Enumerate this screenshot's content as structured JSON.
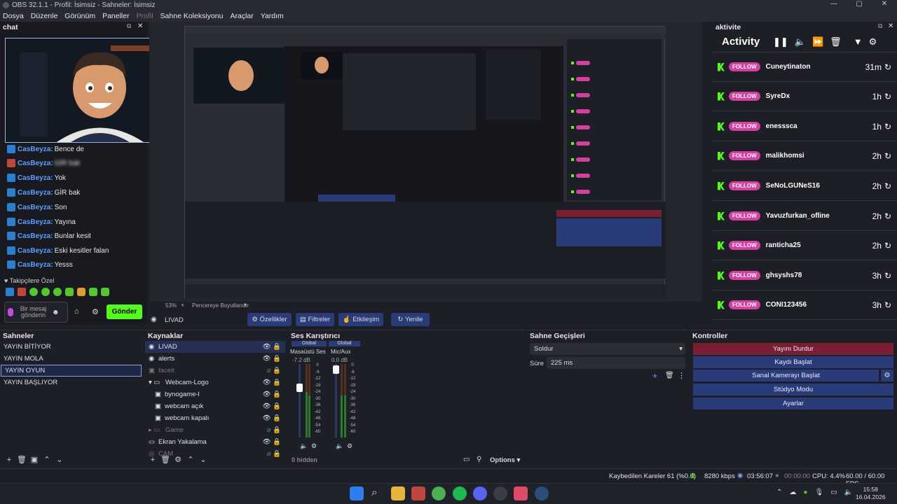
{
  "window": {
    "title": "OBS 32.1.1 - Profil: İsimsiz - Sahneler: İsimsiz",
    "min": "—",
    "max": "▢",
    "close": "✕"
  },
  "menu": [
    "Dosya",
    "Düzenle",
    "Görünüm",
    "Paneller",
    "Profil",
    "Sahne Koleksiyonu",
    "Araçlar",
    "Yardım"
  ],
  "chat": {
    "title": "chat",
    "messages": [
      {
        "user": "CasBeyza:",
        "text": "Bence de"
      },
      {
        "user": "CasBeyza:",
        "text": "GİR bak"
      },
      {
        "user": "CasBeyza:",
        "text": "Yok"
      },
      {
        "user": "CasBeyza:",
        "text": "GİR bak"
      },
      {
        "user": "CasBeyza:",
        "text": "Son"
      },
      {
        "user": "CasBeyza:",
        "text": "Yayına"
      },
      {
        "user": "CasBeyza:",
        "text": "Bunlar kesit"
      },
      {
        "user": "CasBeyza:",
        "text": "Eski kesitler falan"
      },
      {
        "user": "CasBeyza:",
        "text": "Yesss"
      }
    ],
    "followers_label": "Takipçilere Özel",
    "input_placeholder": "Bir mesaj gönderin",
    "send": "Gönder"
  },
  "preview": {
    "zoom": "53%",
    "fit": "Pencereye Boyutlandır"
  },
  "activity": {
    "panel_title": "aktivite",
    "title": "Activity",
    "follow_label": "FOLLOW",
    "items": [
      {
        "name": "Cuneytinaton",
        "ago": "31m"
      },
      {
        "name": "SyreDx",
        "ago": "1h"
      },
      {
        "name": "enesssca",
        "ago": "1h"
      },
      {
        "name": "malikhomsi",
        "ago": "2h"
      },
      {
        "name": "SeNoLGUNeS16",
        "ago": "2h"
      },
      {
        "name": "Yavuzfurkan_ofline",
        "ago": "2h"
      },
      {
        "name": "ranticha25",
        "ago": "2h"
      },
      {
        "name": "ghsyshs78",
        "ago": "3h"
      },
      {
        "name": "CONI123456",
        "ago": "3h"
      }
    ]
  },
  "source_bar": {
    "source": "LIVAD",
    "props": "Özellikler",
    "filters": "Filtreler",
    "interact": "Etkileşim",
    "refresh": "Yenile"
  },
  "scenes": {
    "title": "Sahneler",
    "items": [
      "YAYIN BİTİYOR",
      "YAYIN MOLA",
      "YAYIN OYUN",
      "YAYIN BAŞLIYOR"
    ],
    "selected": 2
  },
  "sources": {
    "title": "Kaynaklar",
    "items": [
      "LIVAD",
      "alerts",
      "faceit",
      "Webcam-Logo",
      "bynogame-l",
      "webcam açık",
      "webcam kapalı",
      "Game",
      "Ekran Yakalama",
      "CAM"
    ]
  },
  "mixer": {
    "title": "Ses Karıştırıcı",
    "ch1": {
      "tag": "Global",
      "name": "Masaüstü Ses",
      "db": "-7.2 dB"
    },
    "ch2": {
      "tag": "Global",
      "name": "Mic/Aux",
      "db": "0.0 dB"
    },
    "scale": [
      "0",
      "-6",
      "-12",
      "-18",
      "-24",
      "-30",
      "-36",
      "-42",
      "-48",
      "-54",
      "-60"
    ],
    "hidden": "0 hidden",
    "options": "Options"
  },
  "transitions": {
    "title": "Sahne Geçişleri",
    "type": "Soldur",
    "duration_label": "Süre",
    "duration": "225 ms"
  },
  "controls": {
    "title": "Kontroller",
    "stop_stream": "Yayını Durdur",
    "record": "Kaydı Başlat",
    "vcam": "Sanal Kamerayı Başlat",
    "studio": "Stüdyo Modu",
    "settings": "Ayarlar"
  },
  "status": {
    "dropped": "Kaybedilen Kareler 61 (%0.0)",
    "kbps": "8280 kbps",
    "live": "03:56:07",
    "rec": "00:00:00",
    "cpu": "CPU: 4.4%",
    "fps": "60.00 / 60.00 FPS"
  },
  "clock": {
    "time": "15:58",
    "date": "16.04.2026"
  },
  "colors": {
    "accent": "#2a3b7a",
    "stop": "#7a1e34",
    "kick": "#53fc18",
    "follow": "#d63ea0"
  }
}
